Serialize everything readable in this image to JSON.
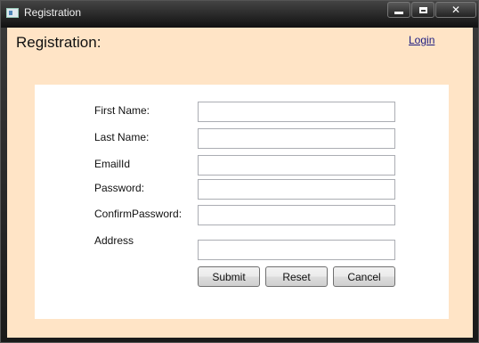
{
  "window": {
    "title": "Registration"
  },
  "header": {
    "title": "Registration:",
    "login_link": "Login"
  },
  "form": {
    "fields": [
      {
        "label": "First Name:",
        "value": ""
      },
      {
        "label": "Last Name:",
        "value": ""
      },
      {
        "label": "EmailId",
        "value": ""
      },
      {
        "label": "Password:",
        "value": ""
      },
      {
        "label": "ConfirmPassword:",
        "value": ""
      },
      {
        "label": "Address",
        "value": ""
      }
    ],
    "buttons": {
      "submit": "Submit",
      "reset": "Reset",
      "cancel": "Cancel"
    }
  },
  "colors": {
    "client_background": "#ffe4c6",
    "panel_background": "#ffffff",
    "link": "#1a1a80"
  },
  "icons": [
    "app-icon",
    "minimize-icon",
    "maximize-icon",
    "close-icon"
  ]
}
